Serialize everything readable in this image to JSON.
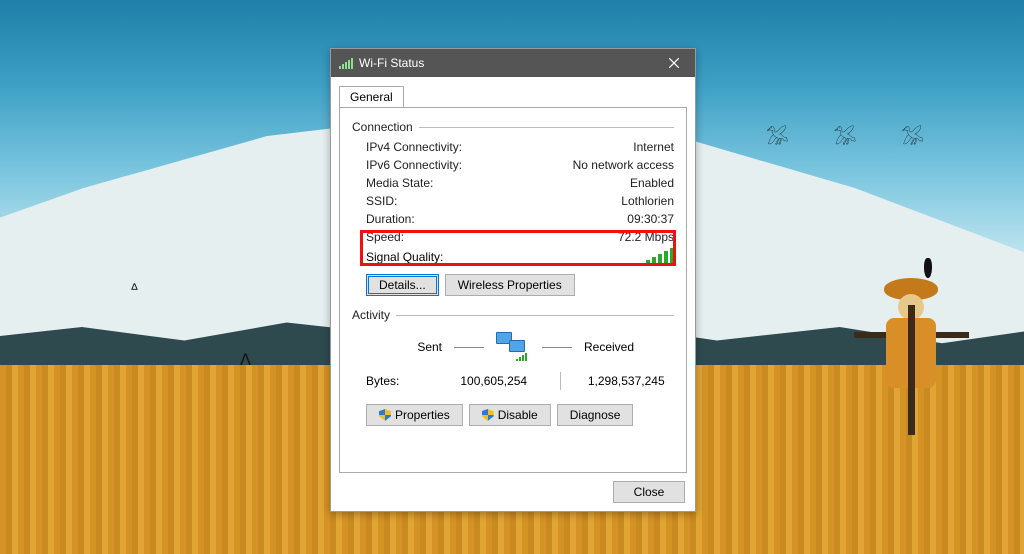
{
  "window": {
    "title": "Wi-Fi Status"
  },
  "tabs": {
    "general": "General"
  },
  "groups": {
    "connection": "Connection",
    "activity": "Activity"
  },
  "connection": {
    "ipv4_label": "IPv4 Connectivity:",
    "ipv4_value": "Internet",
    "ipv6_label": "IPv6 Connectivity:",
    "ipv6_value": "No network access",
    "media_label": "Media State:",
    "media_value": "Enabled",
    "ssid_label": "SSID:",
    "ssid_value": "Lothlorien",
    "duration_label": "Duration:",
    "duration_value": "09:30:37",
    "speed_label": "Speed:",
    "speed_value": "72.2 Mbps",
    "signal_label": "Signal Quality:"
  },
  "buttons": {
    "details": "Details...",
    "wireless": "Wireless Properties",
    "properties": "Properties",
    "disable": "Disable",
    "diagnose": "Diagnose",
    "close": "Close"
  },
  "activity": {
    "sent_label": "Sent",
    "received_label": "Received",
    "bytes_label": "Bytes:",
    "sent_value": "100,605,254",
    "received_value": "1,298,537,245"
  }
}
